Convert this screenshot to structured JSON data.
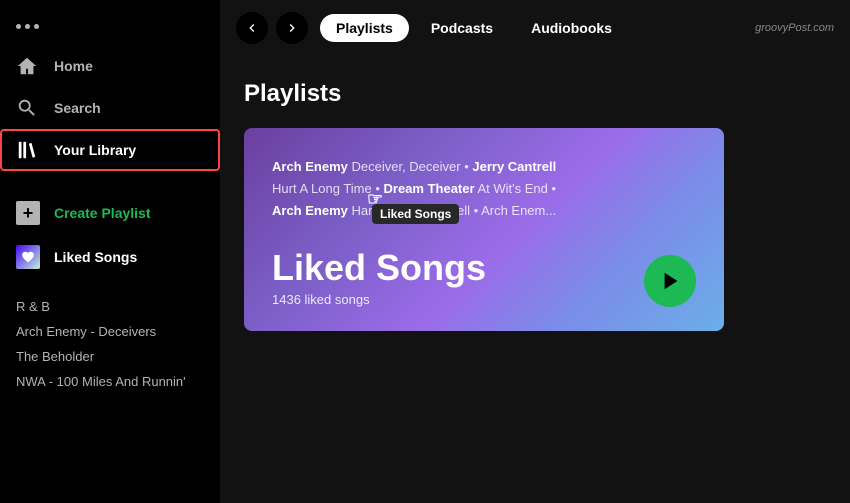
{
  "sidebar": {
    "dots": "···",
    "nav_items": [
      {
        "id": "home",
        "label": "Home",
        "icon": "home-icon",
        "active": false
      },
      {
        "id": "search",
        "label": "Search",
        "icon": "search-icon",
        "active": false
      },
      {
        "id": "library",
        "label": "Your Library",
        "icon": "library-icon",
        "active": true
      }
    ],
    "actions": [
      {
        "id": "create-playlist",
        "label": "Create Playlist",
        "icon": "plus-icon"
      },
      {
        "id": "liked-songs",
        "label": "Liked Songs",
        "icon": "heart-icon"
      }
    ],
    "playlists": [
      {
        "label": "R & B"
      },
      {
        "label": "Arch Enemy - Deceivers"
      },
      {
        "label": "The Beholder"
      },
      {
        "label": "NWA - 100 Miles And Runnin'"
      }
    ]
  },
  "topbar": {
    "tabs": [
      {
        "id": "playlists",
        "label": "Playlists",
        "active": true
      },
      {
        "id": "podcasts",
        "label": "Podcasts",
        "active": false
      },
      {
        "id": "audiobooks",
        "label": "Audiobooks",
        "active": false
      }
    ],
    "watermark": "groovyPost.com"
  },
  "content": {
    "section_title": "Playlists",
    "card": {
      "preview_line1_bold": "Arch Enemy",
      "preview_line1_normal": " Deceiver, Deceiver • ",
      "preview_line1_bold2": "Jerry Cantrell",
      "preview_line2_normal": "Hurt A Long Time • ",
      "preview_line2_bold": "Dream Theater",
      "preview_line2_normal2": " At Wit's End • ",
      "preview_line3_bold": "Arch Enemy",
      "preview_line3_normal": " Handshake with Hell • ",
      "preview_line3_bold2": "Arch Enem...",
      "title": "Liked Songs",
      "subtitle": "1436 liked songs",
      "tooltip": "Liked Songs",
      "play_label": "▶"
    }
  }
}
